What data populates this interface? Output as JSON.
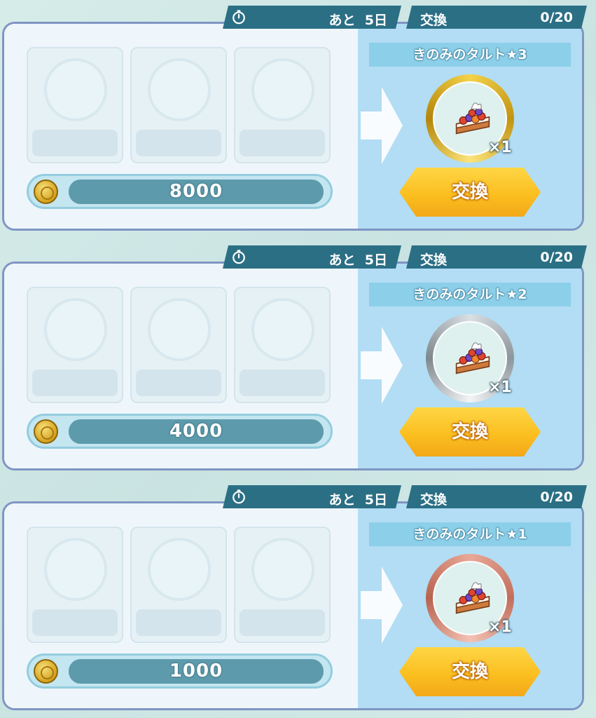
{
  "cards": [
    {
      "timer_prefix": "あと",
      "timer_value": "5日",
      "exchange_label": "交換",
      "exchange_count": "0/20",
      "item_name": "きのみのタルト★3",
      "item_qty": "×1",
      "cost": "8000",
      "button_label": "交換",
      "ring_color": "#d9ab1c"
    },
    {
      "timer_prefix": "あと",
      "timer_value": "5日",
      "exchange_label": "交換",
      "exchange_count": "0/20",
      "item_name": "きのみのタルト★2",
      "item_qty": "×1",
      "cost": "4000",
      "button_label": "交換",
      "ring_color": "#9aa3a9"
    },
    {
      "timer_prefix": "あと",
      "timer_value": "5日",
      "exchange_label": "交換",
      "exchange_count": "0/20",
      "item_name": "きのみのタルト★1",
      "item_qty": "×1",
      "cost": "1000",
      "button_label": "交換",
      "ring_color": "#d48a77"
    }
  ],
  "icons": {
    "timer": "stopwatch-icon",
    "coin": "coin-icon",
    "item": "berry-tart-icon",
    "arrow": "right-arrow-icon"
  }
}
